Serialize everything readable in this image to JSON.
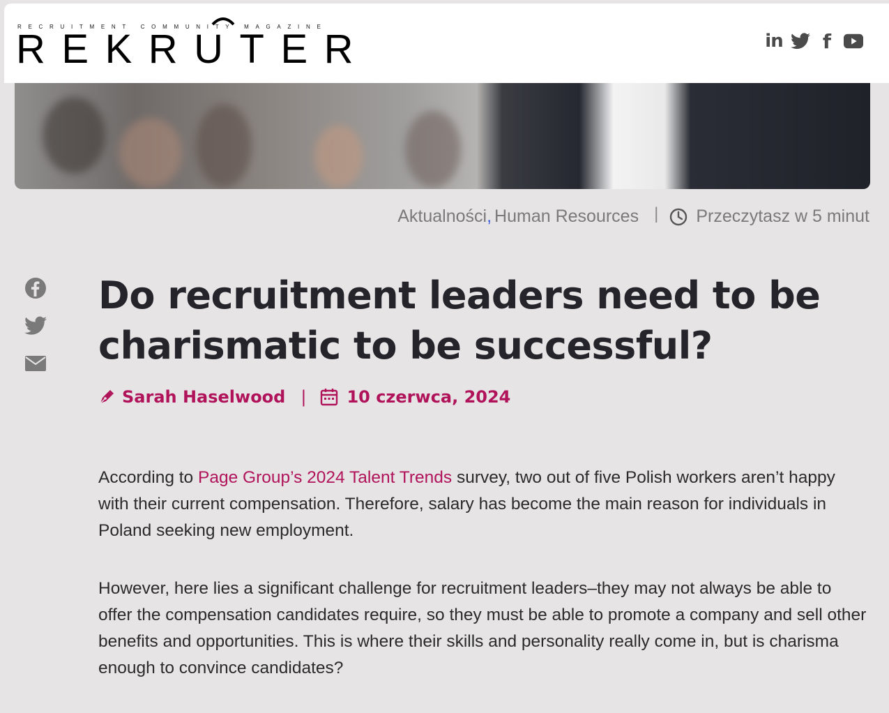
{
  "header": {
    "logo_tagline": "RECRUITMENT COMMUNITY MAGAZINE",
    "logo_word": "REKRUTER",
    "social": [
      {
        "name": "linkedin-icon",
        "glyph": "in"
      },
      {
        "name": "twitter-icon"
      },
      {
        "name": "facebook-icon",
        "glyph": "f"
      },
      {
        "name": "youtube-icon"
      }
    ]
  },
  "meta": {
    "category_1": "Aktualności",
    "comma": ",",
    "category_2": "Human Resources",
    "separator": "|",
    "read_time": "Przeczytasz w 5 minut"
  },
  "article": {
    "title": "Do recruitment leaders need to be charismatic to be successful?",
    "author": "Sarah Haselwood",
    "byline_separator": "|",
    "date": "10 czerwca, 2024",
    "p1_before": "According to ",
    "p1_link": "Page Group’s 2024 Talent Trends",
    "p1_after": " survey, two out of five Polish workers aren’t happy with their current compensation. Therefore, salary has become the main reason for individuals in Poland seeking new employment.",
    "p2": "However, here lies a significant challenge for recruitment leaders–they may not always be able to offer the compensation candidates require, so they must be able to promote a company and sell other benefits and opportunities. This is where their skills and personality really come in, but is charisma enough to convince candidates?"
  },
  "share": [
    "facebook-share-icon",
    "twitter-share-icon",
    "email-share-icon"
  ],
  "colors": {
    "accent": "#b0135a",
    "title": "#24242a",
    "meta": "#7a7a7a",
    "background": "#e6e4e5"
  }
}
